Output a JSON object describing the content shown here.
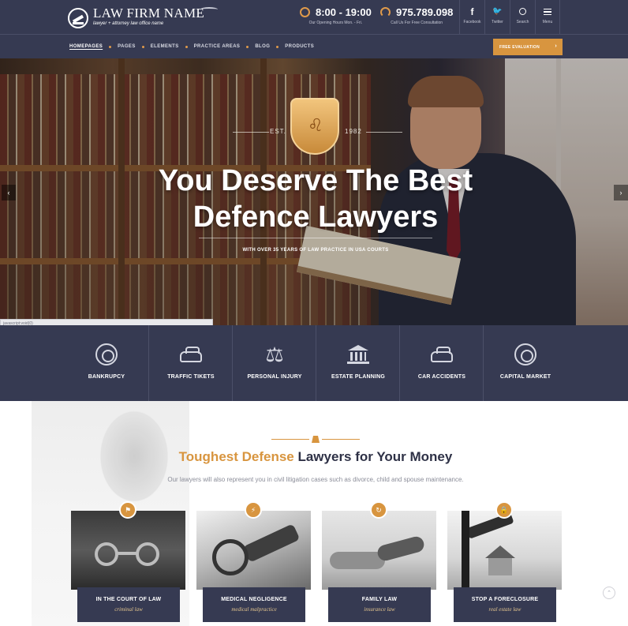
{
  "header": {
    "logo": {
      "name": "LAW FIRM NAME",
      "tagline": "lawyer + attorney law office name"
    },
    "hours": {
      "value": "8:00 - 19:00",
      "caption": "Our Opening Hours Mon. - Fri."
    },
    "phone": {
      "value": "975.789.098",
      "caption": "Call Us For Free Consultation"
    },
    "tools": [
      {
        "glyph": "f",
        "label": "Facebook",
        "icon": "facebook-icon"
      },
      {
        "glyph": "🐦",
        "label": "Twitter",
        "icon": "twitter-icon"
      },
      {
        "glyph": "",
        "label": "Search",
        "icon": "search-icon"
      },
      {
        "glyph": "",
        "label": "Menu",
        "icon": "menu-icon"
      }
    ]
  },
  "nav": {
    "items": [
      "HOMEPAGES",
      "PAGES",
      "ELEMENTS",
      "PRACTICE AREAS",
      "BLOG",
      "PRODUCTS"
    ],
    "active_index": 0,
    "cta_label": "FREE EVALUATION",
    "cta_arrow": "›"
  },
  "hero": {
    "est_left": "EST.",
    "est_right": "1982",
    "title_line1": "You Deserve The Best",
    "title_line2": "Defence Lawyers",
    "subtitle": "WITH OVER 35 YEARS OF LAW PRACTICE IN USA COURTS",
    "prev_arrow": "‹",
    "next_arrow": "›",
    "status_tip": "javascript:void(0)"
  },
  "services": [
    {
      "label": "BANKRUPCY",
      "icon": "target-icon"
    },
    {
      "label": "TRAFFIC TIKETS",
      "icon": "car-icon"
    },
    {
      "label": "PERSONAL INJURY",
      "icon": "scales-icon"
    },
    {
      "label": "ESTATE PLANNING",
      "icon": "courthouse-icon"
    },
    {
      "label": "CAR ACCIDENTS",
      "icon": "car-icon"
    },
    {
      "label": "CAPITAL MARKET",
      "icon": "target-icon"
    }
  ],
  "about": {
    "title_accent": "Toughest Defense",
    "title_rest": " Lawyers for Your Money",
    "subtitle": "Our lawyers will also represent you in civil litigation cases such as divorce, child and spouse maintenance."
  },
  "cards": [
    {
      "title": "IN THE COURT OF LAW",
      "sub": "criminal law",
      "badge_icon": "flag-icon"
    },
    {
      "title": "MEDICAL NEGLIGENCE",
      "sub": "medical malpractice",
      "badge_icon": "bolt-icon"
    },
    {
      "title": "FAMILY LAW",
      "sub": "insurance law",
      "badge_icon": "refresh-icon"
    },
    {
      "title": "STOP A FORECLOSURE",
      "sub": "real estate law",
      "badge_icon": "lock-icon"
    }
  ],
  "colors": {
    "navy": "#363a52",
    "accent": "#d8953f",
    "text": "#2e3146"
  }
}
